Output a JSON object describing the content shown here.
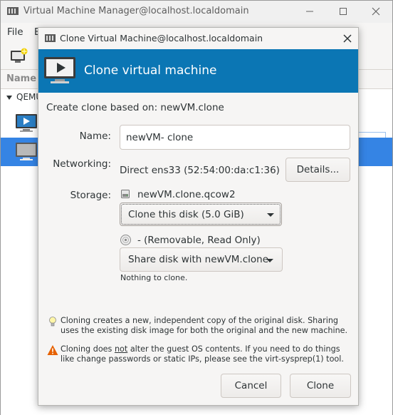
{
  "main_window": {
    "title": "Virtual Machine Manager@localhost.localdomain",
    "menu": [
      "File",
      "E"
    ],
    "list_header": "Name",
    "connection": "QEMU"
  },
  "dialog": {
    "title": "Clone Virtual Machine@localhost.localdomain",
    "banner_title": "Clone virtual machine",
    "clone_base": "Create clone based on:  newVM.clone",
    "name": {
      "label": "Name:",
      "value": "newVM- clone"
    },
    "networking": {
      "label": "Networking:",
      "value": "Direct ens33 (52:54:00:da:c1:36)",
      "button": "Details..."
    },
    "storage": {
      "label": "Storage:",
      "disks": [
        {
          "name": "newVM.clone.qcow2",
          "icon": "hard-disk-icon",
          "selected_option": "Clone this disk (5.0 GiB)"
        },
        {
          "name": "- (Removable, Read Only)",
          "icon": "cdrom-icon",
          "selected_option": "Share disk with newVM.clone",
          "note": "Nothing to clone."
        }
      ]
    },
    "tip": "Cloning creates a new, independent copy of the original disk. Sharing uses the existing disk image for both the original and the new machine.",
    "warning": {
      "prefix": "Cloning does ",
      "emph": "not",
      "suffix": " alter the guest OS contents. If you need to do things like change passwords or static IPs, please see the virt-sysprep(1) tool."
    },
    "buttons": {
      "cancel": "Cancel",
      "clone": "Clone"
    }
  },
  "colors": {
    "banner": "#0b76b4",
    "selection": "#3584e4",
    "warning_icon": "#e66100"
  }
}
